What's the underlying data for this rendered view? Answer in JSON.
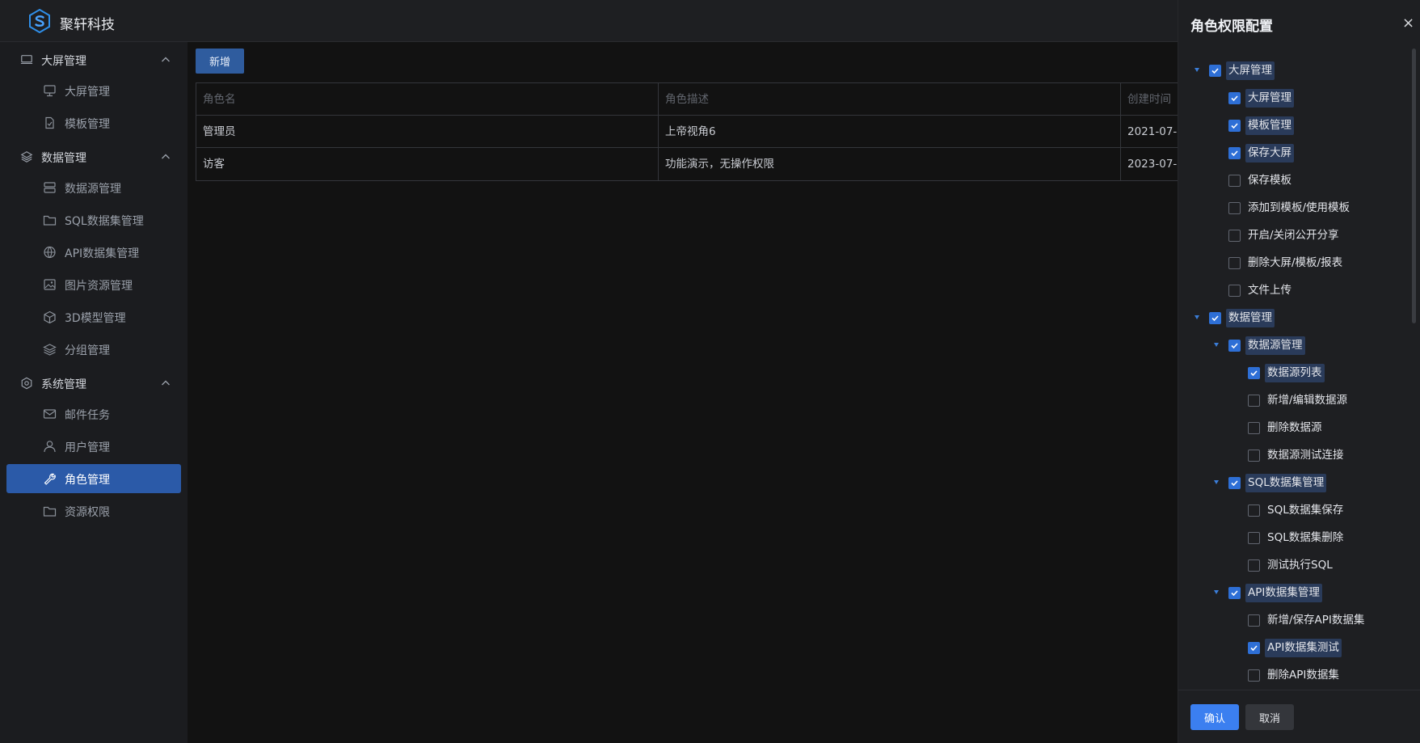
{
  "app": {
    "brand": "聚轩科技"
  },
  "sidebar": {
    "groups": [
      {
        "label": "大屏管理",
        "icon": "monitor-icon",
        "items": [
          {
            "label": "大屏管理",
            "icon": "desktop-icon"
          },
          {
            "label": "模板管理",
            "icon": "template-icon"
          }
        ]
      },
      {
        "label": "数据管理",
        "icon": "layers-icon",
        "items": [
          {
            "label": "数据源管理",
            "icon": "database-icon"
          },
          {
            "label": "SQL数据集管理",
            "icon": "folder-icon"
          },
          {
            "label": "API数据集管理",
            "icon": "globe-icon"
          },
          {
            "label": "图片资源管理",
            "icon": "image-icon"
          },
          {
            "label": "3D模型管理",
            "icon": "cube-icon"
          },
          {
            "label": "分组管理",
            "icon": "stack-icon"
          }
        ]
      },
      {
        "label": "系统管理",
        "icon": "settings-icon",
        "items": [
          {
            "label": "邮件任务",
            "icon": "mail-icon"
          },
          {
            "label": "用户管理",
            "icon": "user-icon"
          },
          {
            "label": "角色管理",
            "icon": "wrench-icon",
            "active": true
          },
          {
            "label": "资源权限",
            "icon": "folder-icon"
          }
        ]
      }
    ]
  },
  "toolbar": {
    "add_label": "新增"
  },
  "table": {
    "headers": [
      "角色名",
      "角色描述",
      "创建时间"
    ],
    "rows": [
      [
        "管理员",
        "上帝视角6",
        "2021-07-"
      ],
      [
        "访客",
        "功能演示，无操作权限",
        "2023-07-"
      ]
    ]
  },
  "drawer": {
    "title": "角色权限配置",
    "close_glyph": "×",
    "ok_label": "确认",
    "cancel_label": "取消",
    "tree": [
      {
        "label": "大屏管理",
        "level": 0,
        "checked": true,
        "expanded": true
      },
      {
        "label": "大屏管理",
        "level": 1,
        "checked": true
      },
      {
        "label": "模板管理",
        "level": 1,
        "checked": true
      },
      {
        "label": "保存大屏",
        "level": 1,
        "checked": true
      },
      {
        "label": "保存模板",
        "level": 1,
        "checked": false
      },
      {
        "label": "添加到模板/使用模板",
        "level": 1,
        "checked": false
      },
      {
        "label": "开启/关闭公开分享",
        "level": 1,
        "checked": false
      },
      {
        "label": "删除大屏/模板/报表",
        "level": 1,
        "checked": false
      },
      {
        "label": "文件上传",
        "level": 1,
        "checked": false
      },
      {
        "label": "数据管理",
        "level": 0,
        "checked": true,
        "expanded": true
      },
      {
        "label": "数据源管理",
        "level": 1,
        "checked": true,
        "expanded": true
      },
      {
        "label": "数据源列表",
        "level": 2,
        "checked": true
      },
      {
        "label": "新增/编辑数据源",
        "level": 2,
        "checked": false
      },
      {
        "label": "删除数据源",
        "level": 2,
        "checked": false
      },
      {
        "label": "数据源测试连接",
        "level": 2,
        "checked": false
      },
      {
        "label": "SQL数据集管理",
        "level": 1,
        "checked": true,
        "expanded": true
      },
      {
        "label": "SQL数据集保存",
        "level": 2,
        "checked": false
      },
      {
        "label": "SQL数据集删除",
        "level": 2,
        "checked": false
      },
      {
        "label": "测试执行SQL",
        "level": 2,
        "checked": false
      },
      {
        "label": "API数据集管理",
        "level": 1,
        "checked": true,
        "expanded": true
      },
      {
        "label": "新增/保存API数据集",
        "level": 2,
        "checked": false
      },
      {
        "label": "API数据集测试",
        "level": 2,
        "checked": true
      },
      {
        "label": "删除API数据集",
        "level": 2,
        "checked": false
      }
    ]
  },
  "colors": {
    "accent": "#2e6fd6",
    "active_nav": "#2b5aa8",
    "background": "#121212",
    "panel": "#1e1f22"
  }
}
